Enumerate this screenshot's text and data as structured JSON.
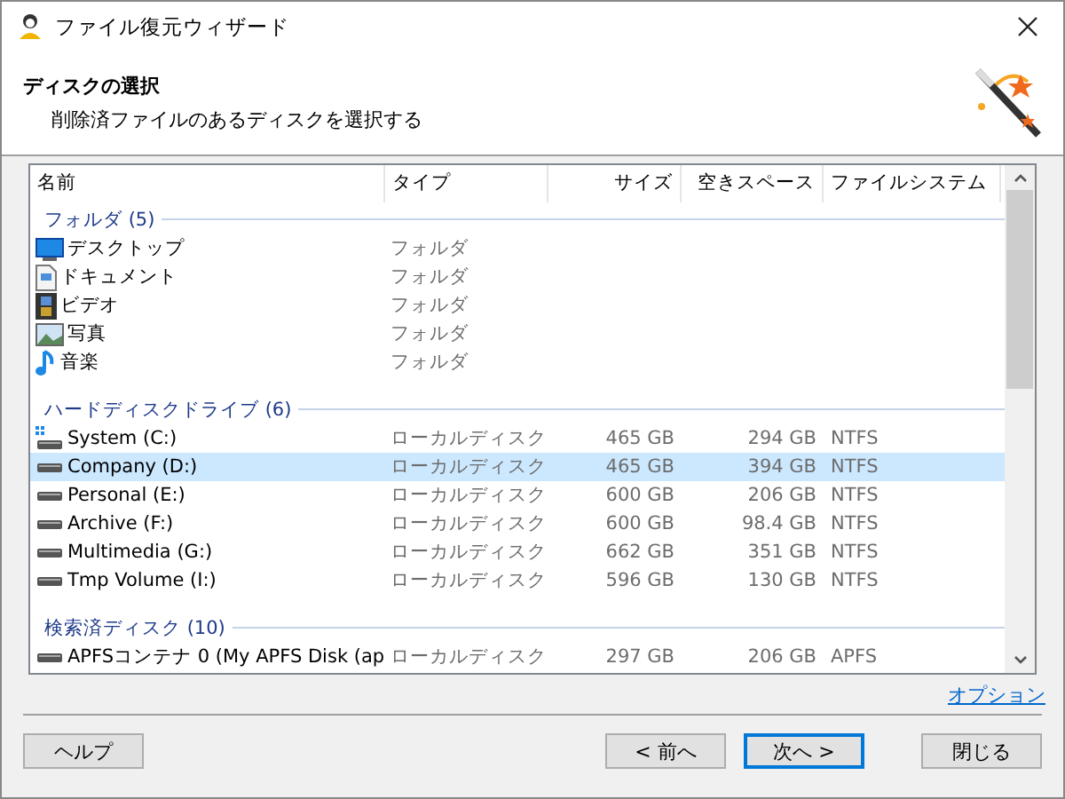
{
  "window": {
    "title": "ファイル復元ウィザード"
  },
  "header": {
    "title": "ディスクの選択",
    "subtitle": "削除済ファイルのあるディスクを選択する"
  },
  "table": {
    "columns": [
      "名前",
      "タイプ",
      "サイズ",
      "空きスペース",
      "ファイルシステム"
    ],
    "groups": [
      {
        "label": "フォルダ (5)",
        "rows": [
          {
            "kind": "desktop",
            "name": "デスクトップ",
            "type": "フォルダ",
            "selected": false
          },
          {
            "kind": "document",
            "name": "ドキュメント",
            "type": "フォルダ",
            "selected": false
          },
          {
            "kind": "video",
            "name": "ビデオ",
            "type": "フォルダ",
            "selected": false
          },
          {
            "kind": "picture",
            "name": "写真",
            "type": "フォルダ",
            "selected": false
          },
          {
            "kind": "music",
            "name": "音楽",
            "type": "フォルダ",
            "selected": false
          }
        ]
      },
      {
        "label": "ハードディスクドライブ (6)",
        "rows": [
          {
            "kind": "system-drive",
            "name": "System (C:)",
            "type": "ローカルディスク",
            "size": "465 GB",
            "free": "294 GB",
            "fs": "NTFS",
            "selected": false
          },
          {
            "kind": "drive",
            "name": "Company (D:)",
            "type": "ローカルディスク",
            "size": "465 GB",
            "free": "394 GB",
            "fs": "NTFS",
            "selected": true
          },
          {
            "kind": "drive",
            "name": "Personal (E:)",
            "type": "ローカルディスク",
            "size": "600 GB",
            "free": "206 GB",
            "fs": "NTFS",
            "selected": false
          },
          {
            "kind": "drive",
            "name": "Archive (F:)",
            "type": "ローカルディスク",
            "size": "600 GB",
            "free": "98.4 GB",
            "fs": "NTFS",
            "selected": false
          },
          {
            "kind": "drive",
            "name": "Multimedia (G:)",
            "type": "ローカルディスク",
            "size": "662 GB",
            "free": "351 GB",
            "fs": "NTFS",
            "selected": false
          },
          {
            "kind": "drive",
            "name": "Tmp Volume (I:)",
            "type": "ローカルディスク",
            "size": "596 GB",
            "free": "130 GB",
            "fs": "NTFS",
            "selected": false
          }
        ]
      },
      {
        "label": "検索済ディスク (10)",
        "rows": [
          {
            "kind": "drive",
            "name": "APFSコンテナ 0 (My APFS Disk (ap",
            "type": "ローカルディスク",
            "size": "297 GB",
            "free": "206 GB",
            "fs": "APFS",
            "selected": false
          }
        ]
      }
    ]
  },
  "options_link": "オプション",
  "buttons": [
    {
      "label": "ヘルプ",
      "focused": false
    },
    {
      "label": "< 前へ",
      "focused": false
    },
    {
      "label": "次へ >",
      "focused": true
    },
    {
      "label": "閉じる",
      "focused": false
    }
  ]
}
